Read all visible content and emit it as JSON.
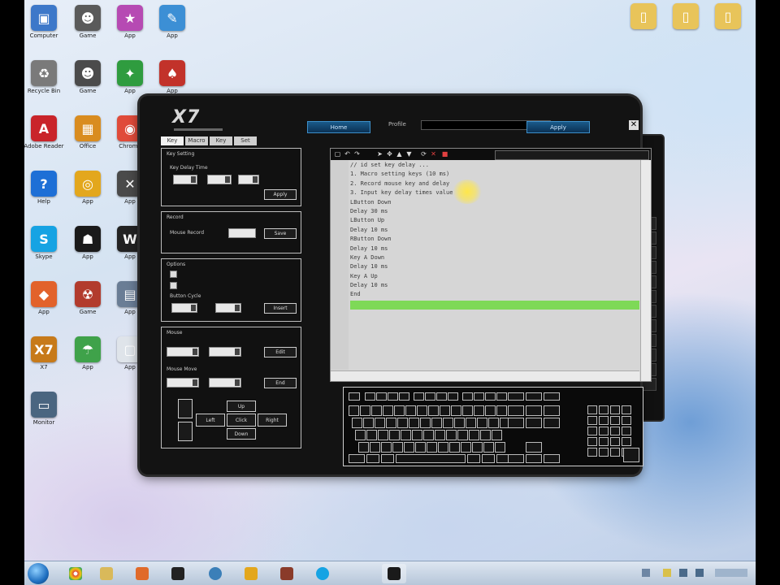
{
  "desktop": {
    "icons": [
      {
        "label": "Computer",
        "icon": "computer-icon",
        "color": "#3d78c9",
        "glyph": "▣"
      },
      {
        "label": "Recycle Bin",
        "icon": "recycle-bin-icon",
        "color": "#7a7a7a",
        "glyph": "♻"
      },
      {
        "label": "Adobe Reader",
        "icon": "pdf-icon",
        "color": "#c9242a",
        "glyph": "A"
      },
      {
        "label": "Help",
        "icon": "help-icon",
        "color": "#1d6fd6",
        "glyph": "?"
      },
      {
        "label": "Skype",
        "icon": "skype-icon",
        "color": "#16a3e3",
        "glyph": "S"
      },
      {
        "label": "App",
        "icon": "flame-icon",
        "color": "#e2622b",
        "glyph": "◆"
      },
      {
        "label": "X7",
        "icon": "x7-icon",
        "color": "#c77a1a",
        "glyph": "X7"
      },
      {
        "label": "Monitor",
        "icon": "monitor-icon",
        "color": "#4a6580",
        "glyph": "▭"
      }
    ],
    "icons_col2": [
      {
        "label": "Game",
        "icon": "game-icon",
        "color": "#5a5a5a",
        "glyph": "☻"
      },
      {
        "label": "Game",
        "icon": "alien-icon",
        "color": "#4b4b4b",
        "glyph": "☻"
      },
      {
        "label": "Office",
        "icon": "office-icon",
        "color": "#d98c1f",
        "glyph": "▦"
      },
      {
        "label": "App",
        "icon": "app-icon",
        "color": "#e3a71d",
        "glyph": "◎"
      },
      {
        "label": "App",
        "icon": "app2-icon",
        "color": "#1a1a1a",
        "glyph": "☗"
      },
      {
        "label": "Game",
        "icon": "game2-icon",
        "color": "#b23b2d",
        "glyph": "☢"
      },
      {
        "label": "App",
        "icon": "umbrella-icon",
        "color": "#3fa24a",
        "glyph": "☂"
      }
    ],
    "icons_col3": [
      {
        "label": "App",
        "icon": "app3-icon",
        "color": "#b64ab3",
        "glyph": "★"
      },
      {
        "label": "App",
        "icon": "app4-icon",
        "color": "#2f9c3f",
        "glyph": "✦"
      },
      {
        "label": "Chrome",
        "icon": "chrome-icon",
        "color": "#e04b3a",
        "glyph": "◉"
      },
      {
        "label": "App",
        "icon": "app5-icon",
        "color": "#4a4a4a",
        "glyph": "✕"
      },
      {
        "label": "App",
        "icon": "app6-icon",
        "color": "#222222",
        "glyph": "W"
      },
      {
        "label": "App",
        "icon": "app7-icon",
        "color": "#6a7d95",
        "glyph": "▤"
      },
      {
        "label": "App",
        "icon": "app8-icon",
        "color": "#dfe4ea",
        "glyph": "▢"
      }
    ],
    "icons_col4": [
      {
        "label": "App",
        "icon": "app9-icon",
        "color": "#3c8fd5",
        "glyph": "✎"
      },
      {
        "label": "App",
        "icon": "app10-icon",
        "color": "#c2322a",
        "glyph": "♠"
      }
    ],
    "icons_right": [
      {
        "label": "",
        "icon": "folder-icon",
        "color": "#e8c45a",
        "glyph": "▯"
      },
      {
        "label": "",
        "icon": "folder2-icon",
        "color": "#e8c45a",
        "glyph": "▯"
      },
      {
        "label": "",
        "icon": "folder3-icon",
        "color": "#e8c45a",
        "glyph": "▯"
      }
    ]
  },
  "app": {
    "logo": "X7",
    "profile_label": "Profile",
    "top_button_left": "Home",
    "top_button_right": "Apply",
    "profile_value": "",
    "tabs": [
      "Key",
      "Macro",
      "Key",
      "Set"
    ],
    "panels": [
      {
        "title": "Key Setting",
        "row": "Key  Delay  Time"
      },
      {
        "title": "Record",
        "row": "Mouse Record"
      },
      {
        "title": "Options",
        "row": "Button  Cycle"
      },
      {
        "title": "Mouse",
        "row": "Mouse Move"
      }
    ],
    "buttons": {
      "apply": "Apply",
      "save": "Save",
      "insert": "Insert",
      "edit": "Edit",
      "end": "End",
      "move_left": "Left",
      "move_right": "Right",
      "move_up": "Up",
      "move_down": "Down",
      "center": "Click"
    }
  },
  "editor": {
    "lines": [
      "// id  set  key  delay  ...",
      "1. Macro  setting  keys  (10  ms)",
      "2. Record  mouse  key  and  delay",
      "3. Input  key  delay  times  value",
      "LButton  Down",
      "Delay  30  ms",
      "LButton  Up",
      "Delay  10  ms",
      "RButton  Down",
      "Delay  10  ms",
      "Key  A  Down",
      "Delay  10  ms",
      "Key  A  Up",
      "Delay  10  ms",
      "End",
      ""
    ],
    "highlight_index": 15
  },
  "colors": {
    "highlight": "#7ed957",
    "accent": "#1a5a8a"
  }
}
